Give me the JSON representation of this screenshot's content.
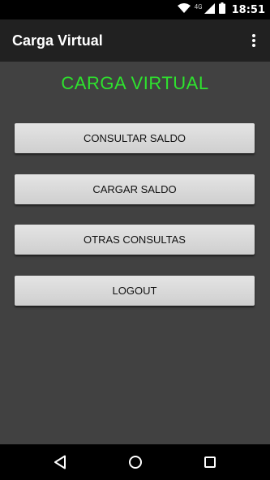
{
  "status_bar": {
    "network_label": "4G",
    "time": "18:51",
    "icons": [
      "wifi-icon",
      "cellular-signal-icon",
      "battery-icon"
    ]
  },
  "app_bar": {
    "title": "Carga Virtual",
    "menu_icon": "overflow-menu-icon"
  },
  "main": {
    "heading": "CARGA VIRTUAL",
    "buttons": [
      {
        "label": "CONSULTAR SALDO"
      },
      {
        "label": "CARGAR SALDO"
      },
      {
        "label": "OTRAS CONSULTAS"
      },
      {
        "label": "LOGOUT"
      }
    ]
  },
  "nav_bar": {
    "icons": [
      "back-icon",
      "home-icon",
      "recents-icon"
    ]
  },
  "colors": {
    "heading": "#2ee22e",
    "content_bg": "#414141",
    "app_bar_bg": "#212121",
    "button_bg": "#d9d9d9"
  }
}
